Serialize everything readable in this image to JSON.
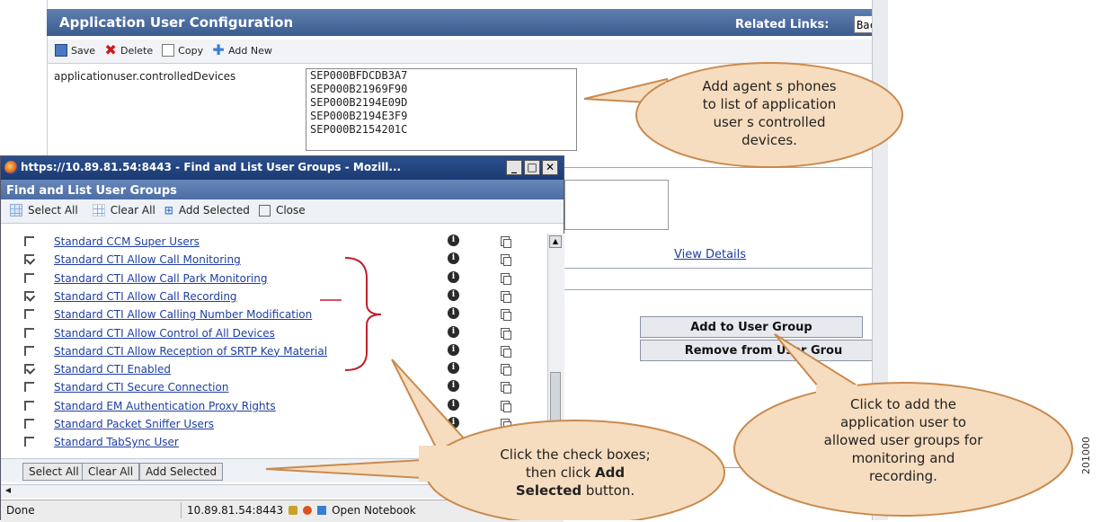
{
  "background_page": {
    "title": "Application User Configuration",
    "related_links_label": "Related Links:",
    "related_links_value": "Bac",
    "toolbar": {
      "save": "Save",
      "delete": "Delete",
      "copy": "Copy",
      "add_new": "Add New"
    },
    "controlled_devices_label": "applicationuser.controlledDevices",
    "controlled_devices": [
      "SEP000BFDCDB3A7",
      "SEP000B21969F90",
      "SEP000B2194E09D",
      "SEP000B2194E3F9",
      "SEP000B2154201C"
    ],
    "view_details": "View Details",
    "add_to_user_group": "Add to User Group",
    "remove_from_user_group": "Remove from User Grou"
  },
  "popup": {
    "window_title": "https://10.89.81.54:8443 - Find and List User Groups - Mozill...",
    "heading": "Find and List User Groups",
    "toolbar": {
      "select_all": "Select All",
      "clear_all": "Clear All",
      "add_selected": "Add Selected",
      "close": "Close"
    },
    "groups": [
      {
        "name": "Standard CCM Super Users",
        "checked": false
      },
      {
        "name": "Standard CTI Allow Call Monitoring",
        "checked": true
      },
      {
        "name": "Standard CTI Allow Call Park Monitoring",
        "checked": false
      },
      {
        "name": "Standard CTI Allow Call Recording",
        "checked": true
      },
      {
        "name": "Standard CTI Allow Calling Number Modification",
        "checked": false
      },
      {
        "name": "Standard CTI Allow Control of All Devices",
        "checked": false
      },
      {
        "name": "Standard CTI Allow Reception of SRTP Key Material",
        "checked": false
      },
      {
        "name": "Standard CTI Enabled",
        "checked": true
      },
      {
        "name": "Standard CTI Secure Connection",
        "checked": false
      },
      {
        "name": "Standard EM Authentication Proxy Rights",
        "checked": false
      },
      {
        "name": "Standard Packet Sniffer Users",
        "checked": false
      },
      {
        "name": "Standard TabSync User",
        "checked": false
      }
    ],
    "bottom_buttons": {
      "select_all": "Select All",
      "clear_all": "Clear All",
      "add_selected": "Add Selected"
    },
    "status": {
      "done": "Done",
      "host": "10.89.81.54:8443",
      "notebook": "Open Notebook"
    }
  },
  "callouts": {
    "devices_lines": [
      "Add agent s phones",
      "to list of application",
      "user s controlled",
      "devices."
    ],
    "checkbox_line1": "Click the check boxes;",
    "checkbox_line2": "then click",
    "checkbox_bold1": "Add",
    "checkbox_bold2": "Selected",
    "checkbox_line3": "button.",
    "usergroup_lines": [
      "Click to add the",
      "application user to",
      "allowed user groups for",
      "monitoring and",
      "recording."
    ]
  },
  "figure_id": "201000",
  "colors": {
    "header_blue": "#3b5c8f",
    "popup_title_blue": "#1b3a72",
    "link_blue": "#1f3fa0",
    "callout_fill": "#f7ddbf",
    "callout_stroke": "#c98a4e",
    "bracket_red": "#c0202c"
  }
}
